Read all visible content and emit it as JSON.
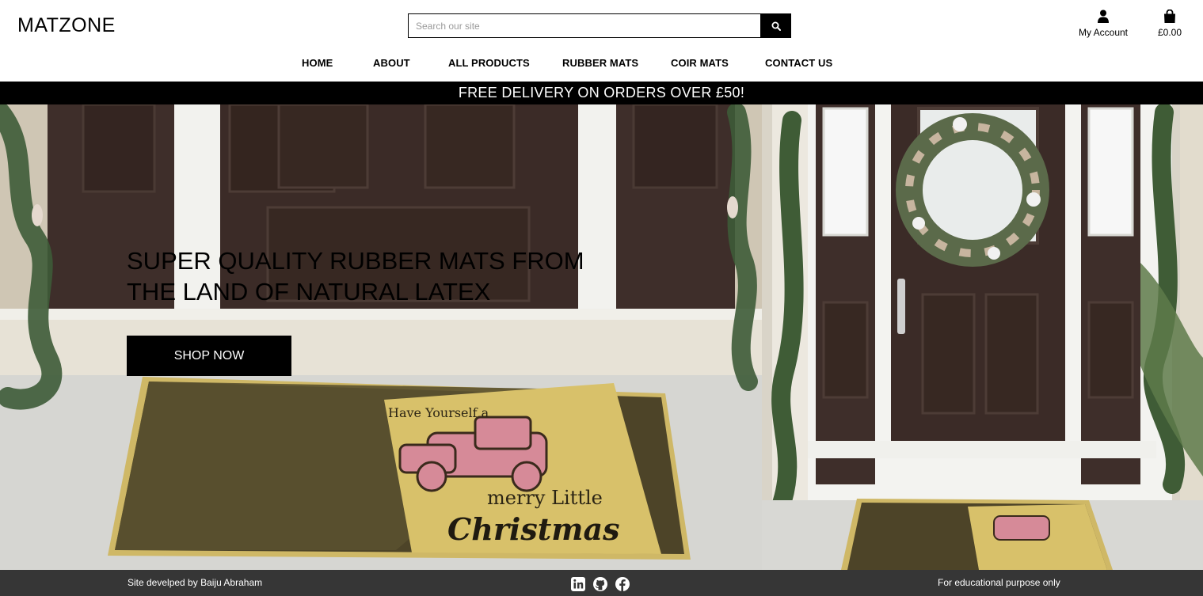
{
  "header": {
    "logo": "MATZONE",
    "search": {
      "placeholder": "Search our site",
      "value": ""
    },
    "account_label": "My Account",
    "cart_total": "£0.00"
  },
  "nav": {
    "items": [
      {
        "label": "HOME"
      },
      {
        "label": "ABOUT"
      },
      {
        "label": "ALL PRODUCTS"
      },
      {
        "label": "RUBBER MATS"
      },
      {
        "label": "COIR MATS"
      },
      {
        "label": "CONTACT US"
      }
    ]
  },
  "banner": {
    "text": "FREE DELIVERY ON ORDERS OVER £50!"
  },
  "hero": {
    "headline_line1": "SUPER QUALITY RUBBER MATS FROM",
    "headline_line2": "THE LAND OF NATURAL LATEX",
    "cta_label": "SHOP NOW",
    "mat_text_1": "Have Yourself a",
    "mat_text_2": "merry Little",
    "mat_text_3": "Christmas"
  },
  "footer": {
    "credit": "Site develped by Baiju Abraham",
    "purpose": "For educational purpose only",
    "socials": [
      "linkedin-icon",
      "github-icon",
      "facebook-icon"
    ]
  },
  "colors": {
    "black": "#000000",
    "footer_bg": "#363636",
    "door_brown": "#3e2e2a",
    "mat_gold": "#d8c16a",
    "truck_pink": "#d68a98"
  }
}
